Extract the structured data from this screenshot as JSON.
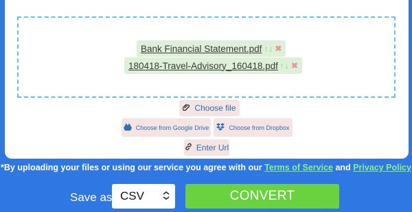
{
  "files": [
    {
      "name": "Bank Financial Statement.pdf"
    },
    {
      "name": "180418-Travel-Advisory_160418.pdf"
    }
  ],
  "file_actions": {
    "up_icon": "arrow-up-icon",
    "down_icon": "arrow-down-icon",
    "remove_icon": "close-icon"
  },
  "buttons": {
    "choose_file": "Choose file",
    "google_drive": "Choose from Google Drive",
    "dropbox": "Choose from Dropbox",
    "enter_url": "Enter Url"
  },
  "notice": {
    "prefix": "*By uploading your files or using our service you agree with our",
    "terms": "Terms of Service",
    "and": "and",
    "privacy": "Privacy Policy"
  },
  "save_as": {
    "label": "Save as",
    "selected": "CSV"
  },
  "convert_label": "CONVERT",
  "colors": {
    "background": "#2f78e3",
    "convert": "#6ad13f",
    "link_green": "#8ef07a",
    "dropzone_border": "#5cc4ee"
  }
}
